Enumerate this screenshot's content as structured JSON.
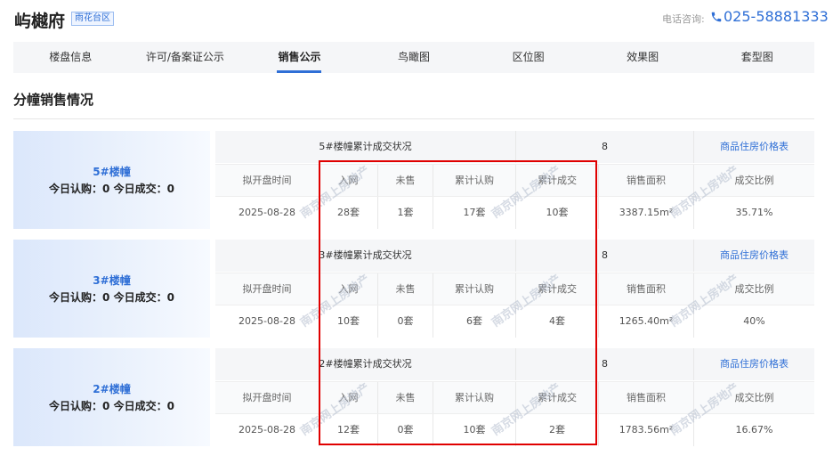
{
  "header": {
    "title": "屿樾府",
    "district": "雨花台区",
    "phone_label": "电话咨询:",
    "phone": "025-58881333"
  },
  "nav": {
    "tabs": [
      {
        "label": "楼盘信息"
      },
      {
        "label": "许可/备案证公示"
      },
      {
        "label": "销售公示",
        "active": true
      },
      {
        "label": "鸟瞰图"
      },
      {
        "label": "区位图"
      },
      {
        "label": "效果图"
      },
      {
        "label": "套型图"
      }
    ]
  },
  "section_title": "分幢销售情况",
  "columns": [
    "拟开盘时间",
    "入网",
    "未售",
    "累计认购",
    "累计成交",
    "销售面积",
    "成交比例"
  ],
  "price_link": "商品住房价格表",
  "watermark": "南京网上房地产",
  "accent_color": "#2f6fd6",
  "highlight_color": "#e00000",
  "buildings": [
    {
      "name": "5#楼幢",
      "today": "今日认购：0 今日成交：0",
      "status_title": "5#楼幢累计成交状况",
      "units_count": "8",
      "values": [
        "2025-08-28",
        "28套",
        "1套",
        "17套",
        "10套",
        "3387.15m²",
        "35.71%"
      ]
    },
    {
      "name": "3#楼幢",
      "today": "今日认购：0 今日成交：0",
      "status_title": "3#楼幢累计成交状况",
      "units_count": "8",
      "values": [
        "2025-08-28",
        "10套",
        "0套",
        "6套",
        "4套",
        "1265.40m²",
        "40%"
      ]
    },
    {
      "name": "2#楼幢",
      "today": "今日认购：0 今日成交：0",
      "status_title": "2#楼幢累计成交状况",
      "units_count": "8",
      "values": [
        "2025-08-28",
        "12套",
        "0套",
        "10套",
        "2套",
        "1783.56m²",
        "16.67%"
      ]
    }
  ]
}
